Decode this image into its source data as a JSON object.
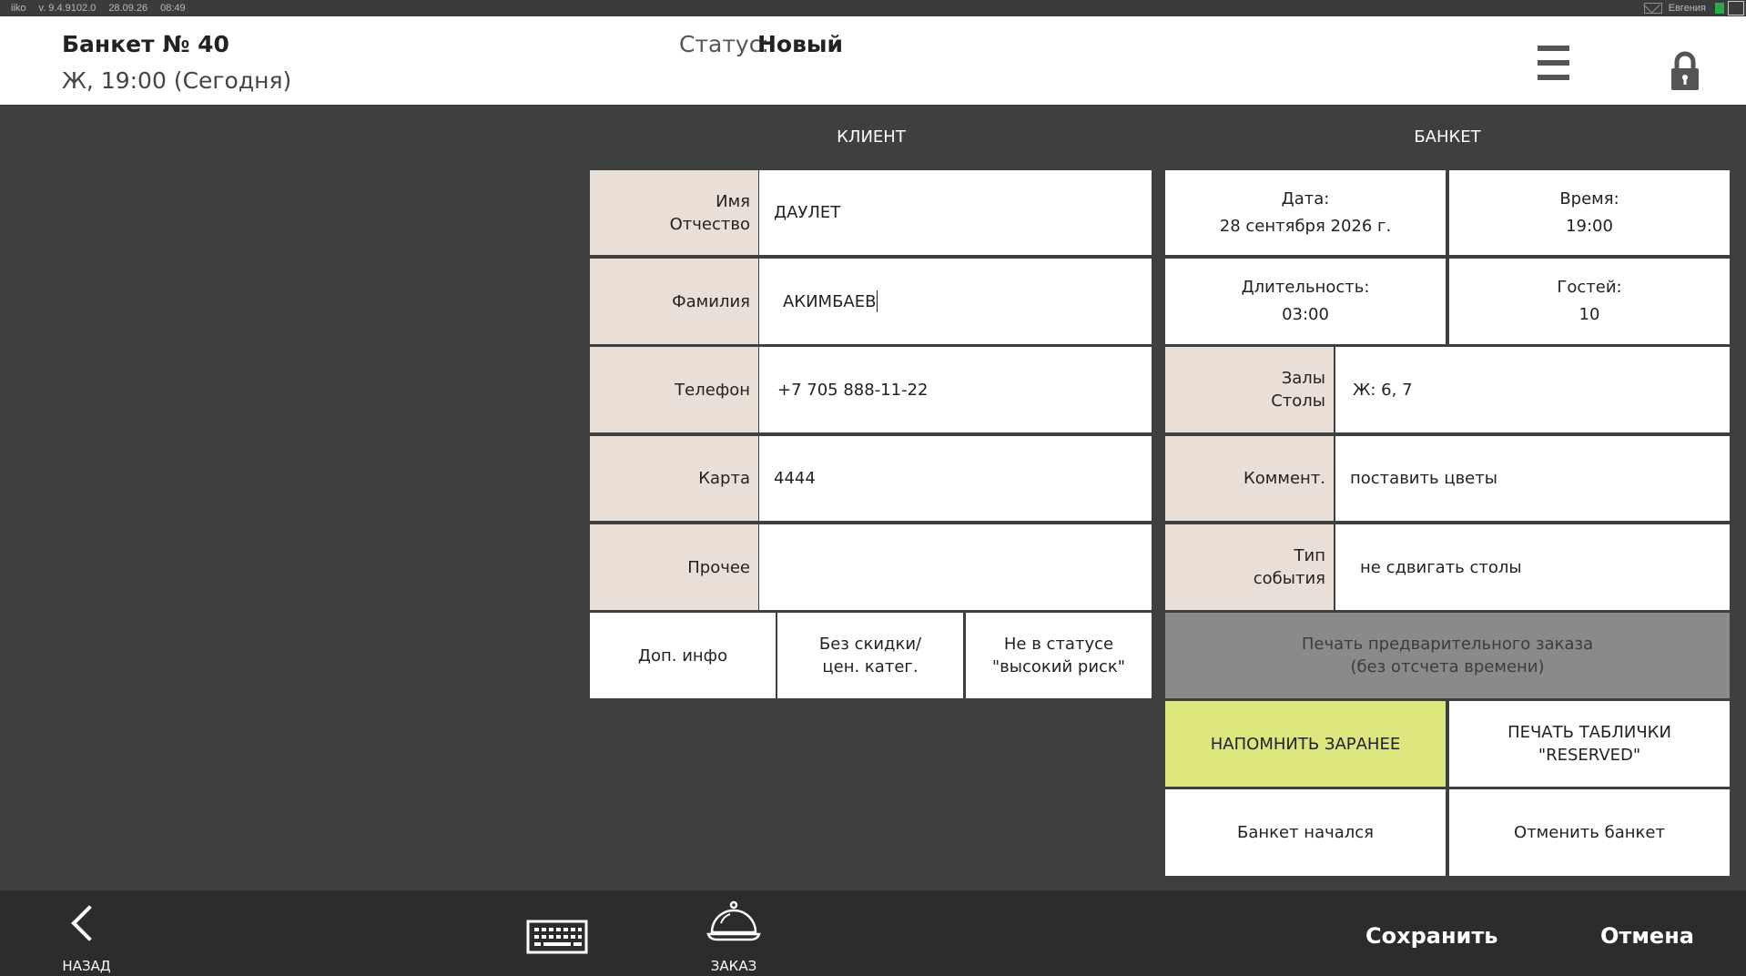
{
  "system": {
    "app": "iiko",
    "version": "v. 9.4.9102.0",
    "date": "28.09.26",
    "time": "08:49",
    "user": "Евгения"
  },
  "header": {
    "title": "Банкет № 40",
    "subtitle": "Ж, 19:00 (Сегодня)",
    "status_label": "Статус:",
    "status_value": "Новый"
  },
  "client": {
    "section_title": "КЛИЕНТ",
    "name_label": "Имя\nОтчество",
    "name_value": "ДАУЛЕТ",
    "surname_label": "Фамилия",
    "surname_value": "АКИМБАЕВ",
    "phone_label": "Телефон",
    "phone_value": "+7 705 888-11-22",
    "card_label": "Карта",
    "card_value": "4444",
    "other_label": "Прочее",
    "other_value": "",
    "extra_info_button": "Доп. инфо",
    "no_discount_button": "Без скидки/\nцен. катег.",
    "risk_button": "Не в статусе\n\"высокий риск\""
  },
  "banquet": {
    "section_title": "БАНКЕТ",
    "date_label": "Дата:",
    "date_value": "28 сентября 2026 г.",
    "time_label": "Время:",
    "time_value": "19:00",
    "duration_label": "Длительность:",
    "duration_value": "03:00",
    "guests_label": "Гостей:",
    "guests_value": "10",
    "halls_label": "Залы\nСтолы",
    "halls_value": "Ж: 6, 7",
    "comment_label": "Коммент.",
    "comment_value": "поставить цветы",
    "event_type_label": "Тип\nсобытия",
    "event_type_value": "не сдвигать столы",
    "print_preorder_button": "Печать предварительного заказа\n(без отсчета времени)",
    "remind_button": "НАПОМНИТЬ ЗАРАНЕЕ",
    "print_reserved_button": "ПЕЧАТЬ ТАБЛИЧКИ\n\"RESERVED\"",
    "started_button": "Банкет начался",
    "cancel_banquet_button": "Отменить банкет"
  },
  "footer": {
    "back_label": "НАЗАД",
    "order_label": "ЗАКАЗ",
    "save_label": "Сохранить",
    "cancel_label": "Отмена"
  },
  "colors": {
    "label_bg": "#e9dfd6",
    "accent_yellow": "#dde57d",
    "disabled_grey": "#8a8a8a",
    "background": "#3e4040"
  }
}
